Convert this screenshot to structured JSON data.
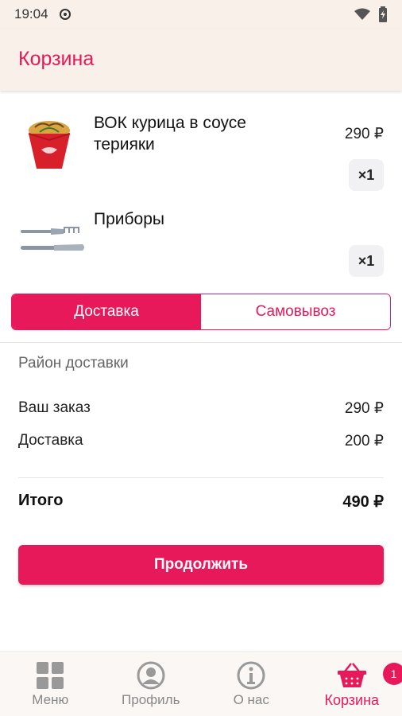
{
  "status_bar": {
    "time": "19:04"
  },
  "header": {
    "title": "Корзина"
  },
  "cart": {
    "items": [
      {
        "name": "ВОК курица в соусе терияки",
        "price": "290 ₽",
        "quantity": "×1"
      },
      {
        "name": "Приборы",
        "price": "",
        "quantity": "×1"
      }
    ]
  },
  "delivery_toggle": {
    "delivery_label": "Доставка",
    "pickup_label": "Самовывоз",
    "selected": "Доставка"
  },
  "district_label": "Район доставки",
  "summary": {
    "order_label": "Ваш заказ",
    "order_value": "290 ₽",
    "delivery_label": "Доставка",
    "delivery_value": "200 ₽",
    "total_label": "Итого",
    "total_value": "490 ₽"
  },
  "continue_label": "Продолжить",
  "bottom_nav": {
    "items": [
      {
        "label": "Меню",
        "icon": "grid-icon"
      },
      {
        "label": "Профиль",
        "icon": "profile-icon"
      },
      {
        "label": "О нас",
        "icon": "info-icon"
      },
      {
        "label": "Корзина",
        "icon": "basket-icon"
      }
    ],
    "cart_badge": "1",
    "active": "Корзина"
  },
  "colors": {
    "accent": "#e8195a",
    "header_bg": "#faf0ea",
    "qty_bg": "#f1f1f3"
  }
}
